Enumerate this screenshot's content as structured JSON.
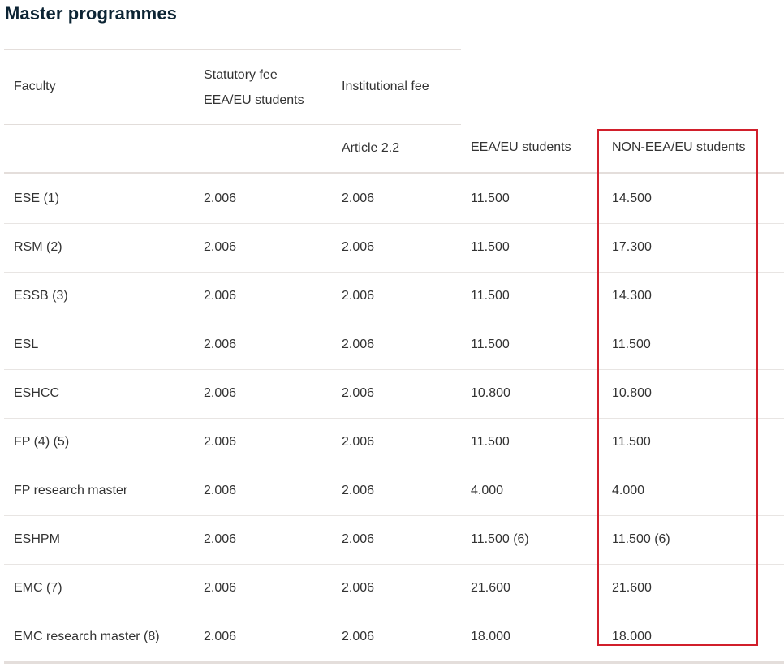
{
  "title": "Master programmes",
  "header": {
    "faculty": "Faculty",
    "statutory_fee": "Statutory fee",
    "statutory_sub": "EEA/EU students",
    "institutional_fee": "Institutional fee",
    "article": "Article 2.2",
    "eea_students": "EEA/EU students",
    "non_eea_students": "NON-EEA/EU students"
  },
  "rows": [
    [
      "ESE (1)",
      "2.006",
      "2.006",
      "11.500",
      "14.500"
    ],
    [
      "RSM (2)",
      "2.006",
      "2.006",
      "11.500",
      "17.300"
    ],
    [
      "ESSB (3)",
      "2.006",
      "2.006",
      "11.500",
      "14.300"
    ],
    [
      "ESL",
      "2.006",
      "2.006",
      "11.500",
      "11.500"
    ],
    [
      "ESHCC",
      "2.006",
      "2.006",
      "10.800",
      "10.800"
    ],
    [
      "FP (4) (5)",
      "2.006",
      "2.006",
      "11.500",
      "11.500"
    ],
    [
      "FP research master",
      "2.006",
      "2.006",
      "4.000",
      "4.000"
    ],
    [
      "ESHPM",
      "2.006",
      "2.006",
      "11.500 (6)",
      "11.500 (6)"
    ],
    [
      "EMC (7)",
      "2.006",
      "2.006",
      "21.600",
      "21.600"
    ],
    [
      "EMC research master (8)",
      "2.006",
      "2.006",
      "18.000",
      "18.000"
    ]
  ],
  "highlight_color": "#d11f2b"
}
